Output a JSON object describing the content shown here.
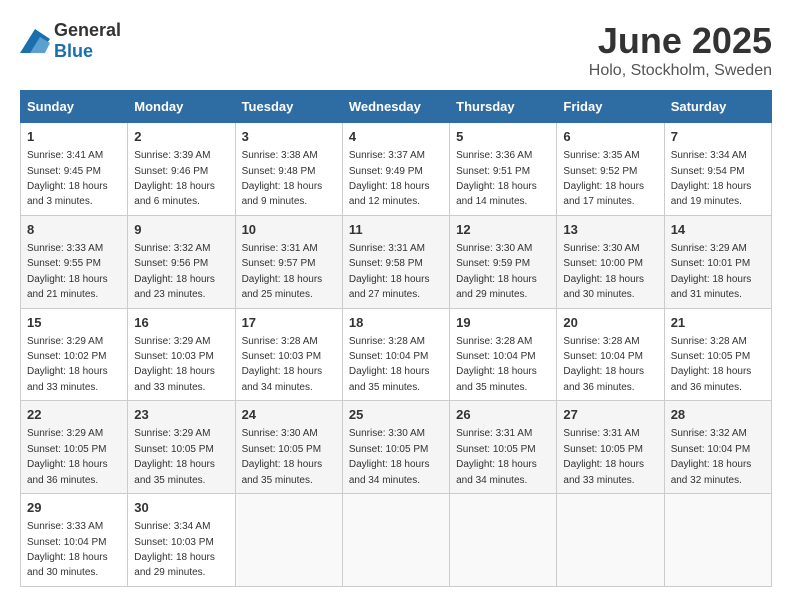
{
  "logo": {
    "general": "General",
    "blue": "Blue"
  },
  "title": "June 2025",
  "subtitle": "Holo, Stockholm, Sweden",
  "days_of_week": [
    "Sunday",
    "Monday",
    "Tuesday",
    "Wednesday",
    "Thursday",
    "Friday",
    "Saturday"
  ],
  "weeks": [
    [
      {
        "day": "1",
        "sunrise": "3:41 AM",
        "sunset": "9:45 PM",
        "daylight": "18 hours and 3 minutes."
      },
      {
        "day": "2",
        "sunrise": "3:39 AM",
        "sunset": "9:46 PM",
        "daylight": "18 hours and 6 minutes."
      },
      {
        "day": "3",
        "sunrise": "3:38 AM",
        "sunset": "9:48 PM",
        "daylight": "18 hours and 9 minutes."
      },
      {
        "day": "4",
        "sunrise": "3:37 AM",
        "sunset": "9:49 PM",
        "daylight": "18 hours and 12 minutes."
      },
      {
        "day": "5",
        "sunrise": "3:36 AM",
        "sunset": "9:51 PM",
        "daylight": "18 hours and 14 minutes."
      },
      {
        "day": "6",
        "sunrise": "3:35 AM",
        "sunset": "9:52 PM",
        "daylight": "18 hours and 17 minutes."
      },
      {
        "day": "7",
        "sunrise": "3:34 AM",
        "sunset": "9:54 PM",
        "daylight": "18 hours and 19 minutes."
      }
    ],
    [
      {
        "day": "8",
        "sunrise": "3:33 AM",
        "sunset": "9:55 PM",
        "daylight": "18 hours and 21 minutes."
      },
      {
        "day": "9",
        "sunrise": "3:32 AM",
        "sunset": "9:56 PM",
        "daylight": "18 hours and 23 minutes."
      },
      {
        "day": "10",
        "sunrise": "3:31 AM",
        "sunset": "9:57 PM",
        "daylight": "18 hours and 25 minutes."
      },
      {
        "day": "11",
        "sunrise": "3:31 AM",
        "sunset": "9:58 PM",
        "daylight": "18 hours and 27 minutes."
      },
      {
        "day": "12",
        "sunrise": "3:30 AM",
        "sunset": "9:59 PM",
        "daylight": "18 hours and 29 minutes."
      },
      {
        "day": "13",
        "sunrise": "3:30 AM",
        "sunset": "10:00 PM",
        "daylight": "18 hours and 30 minutes."
      },
      {
        "day": "14",
        "sunrise": "3:29 AM",
        "sunset": "10:01 PM",
        "daylight": "18 hours and 31 minutes."
      }
    ],
    [
      {
        "day": "15",
        "sunrise": "3:29 AM",
        "sunset": "10:02 PM",
        "daylight": "18 hours and 33 minutes."
      },
      {
        "day": "16",
        "sunrise": "3:29 AM",
        "sunset": "10:03 PM",
        "daylight": "18 hours and 33 minutes."
      },
      {
        "day": "17",
        "sunrise": "3:28 AM",
        "sunset": "10:03 PM",
        "daylight": "18 hours and 34 minutes."
      },
      {
        "day": "18",
        "sunrise": "3:28 AM",
        "sunset": "10:04 PM",
        "daylight": "18 hours and 35 minutes."
      },
      {
        "day": "19",
        "sunrise": "3:28 AM",
        "sunset": "10:04 PM",
        "daylight": "18 hours and 35 minutes."
      },
      {
        "day": "20",
        "sunrise": "3:28 AM",
        "sunset": "10:04 PM",
        "daylight": "18 hours and 36 minutes."
      },
      {
        "day": "21",
        "sunrise": "3:28 AM",
        "sunset": "10:05 PM",
        "daylight": "18 hours and 36 minutes."
      }
    ],
    [
      {
        "day": "22",
        "sunrise": "3:29 AM",
        "sunset": "10:05 PM",
        "daylight": "18 hours and 36 minutes."
      },
      {
        "day": "23",
        "sunrise": "3:29 AM",
        "sunset": "10:05 PM",
        "daylight": "18 hours and 35 minutes."
      },
      {
        "day": "24",
        "sunrise": "3:30 AM",
        "sunset": "10:05 PM",
        "daylight": "18 hours and 35 minutes."
      },
      {
        "day": "25",
        "sunrise": "3:30 AM",
        "sunset": "10:05 PM",
        "daylight": "18 hours and 34 minutes."
      },
      {
        "day": "26",
        "sunrise": "3:31 AM",
        "sunset": "10:05 PM",
        "daylight": "18 hours and 34 minutes."
      },
      {
        "day": "27",
        "sunrise": "3:31 AM",
        "sunset": "10:05 PM",
        "daylight": "18 hours and 33 minutes."
      },
      {
        "day": "28",
        "sunrise": "3:32 AM",
        "sunset": "10:04 PM",
        "daylight": "18 hours and 32 minutes."
      }
    ],
    [
      {
        "day": "29",
        "sunrise": "3:33 AM",
        "sunset": "10:04 PM",
        "daylight": "18 hours and 30 minutes."
      },
      {
        "day": "30",
        "sunrise": "3:34 AM",
        "sunset": "10:03 PM",
        "daylight": "18 hours and 29 minutes."
      },
      null,
      null,
      null,
      null,
      null
    ]
  ]
}
